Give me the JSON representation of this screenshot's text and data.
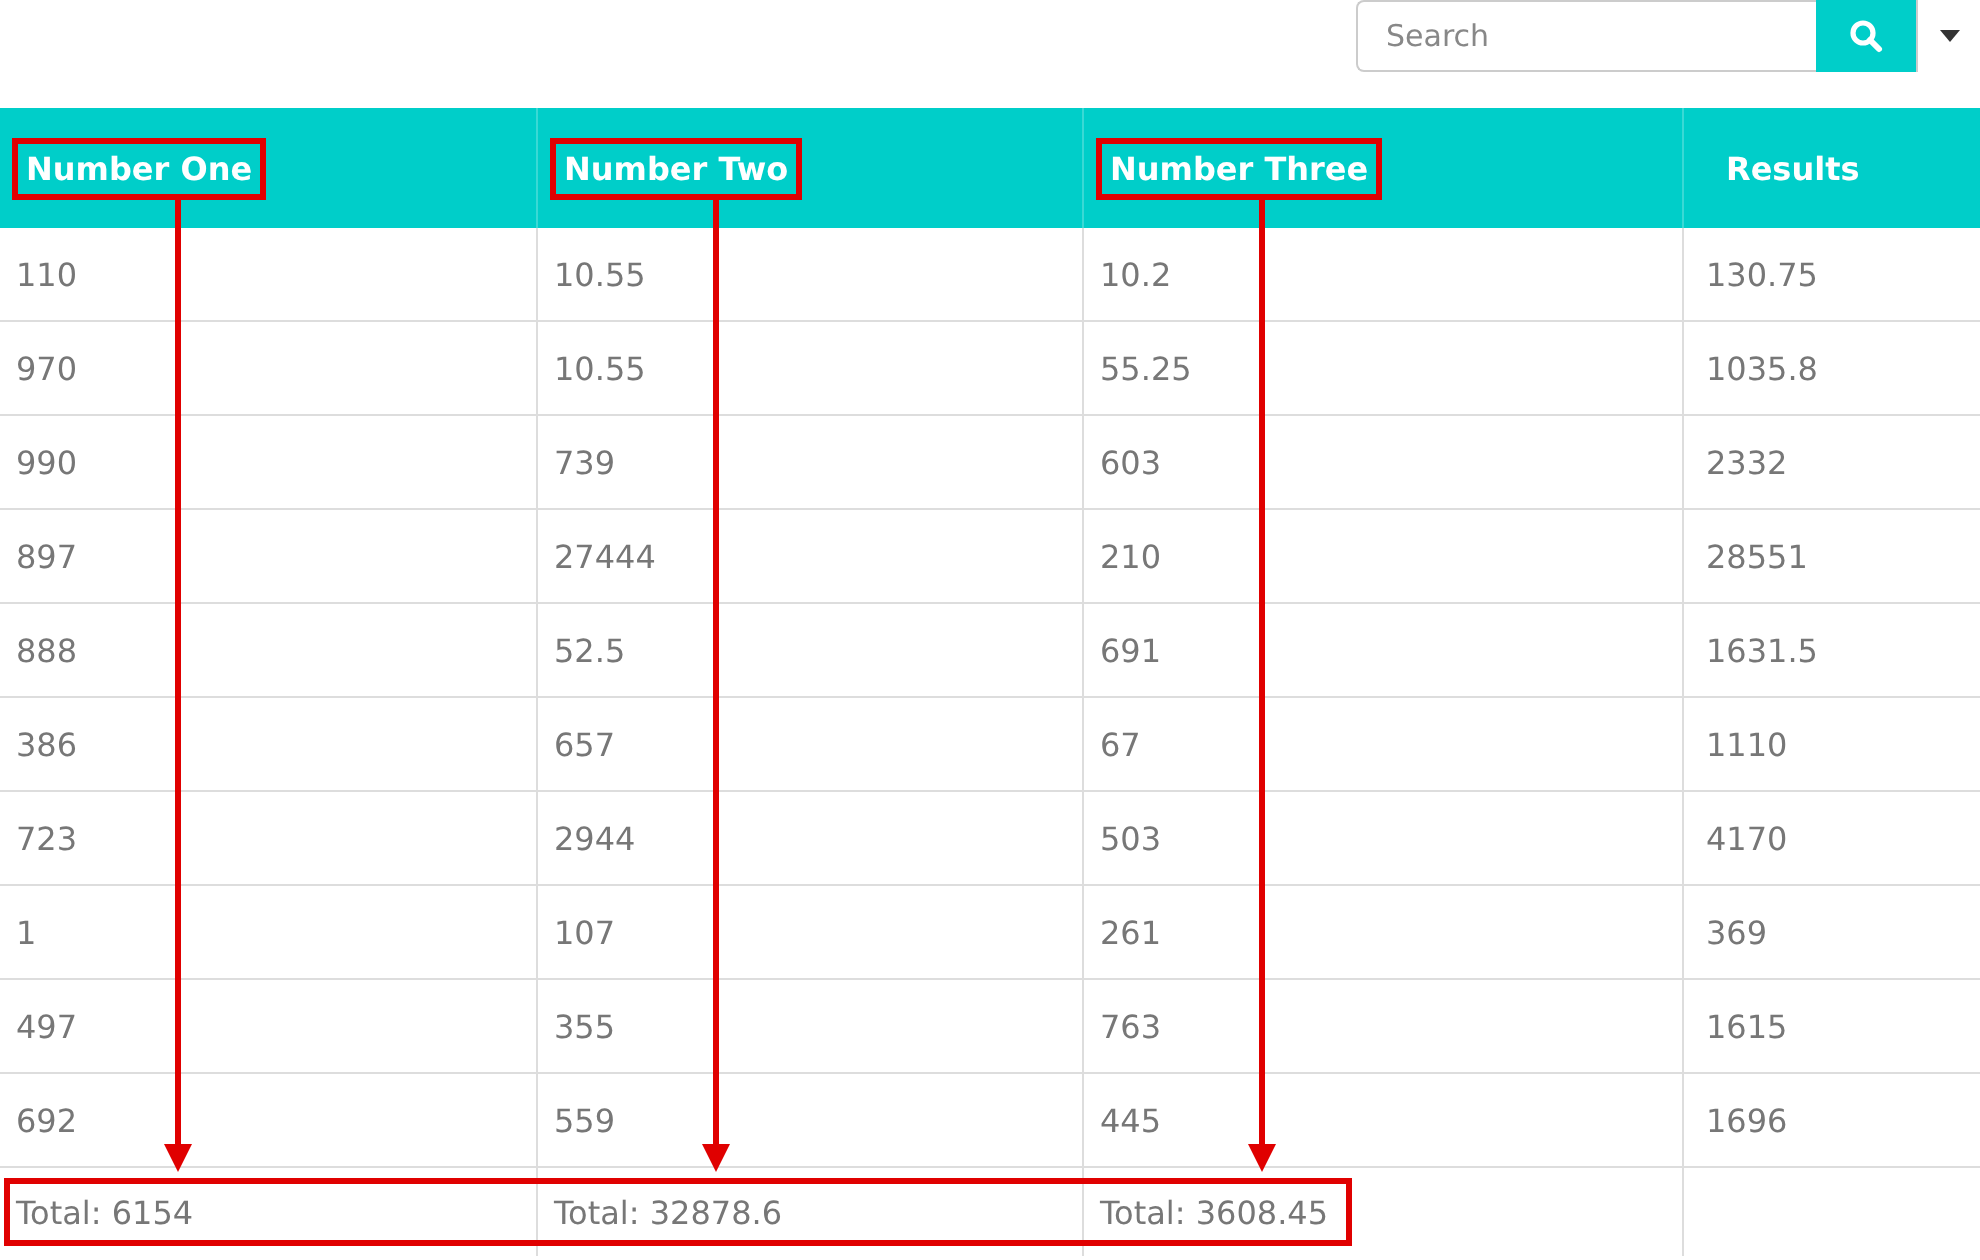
{
  "search": {
    "placeholder": "Search"
  },
  "table": {
    "columns": [
      {
        "label": "Number One",
        "highlighted": true
      },
      {
        "label": "Number Two",
        "highlighted": true
      },
      {
        "label": "Number Three",
        "highlighted": true
      },
      {
        "label": "Results",
        "highlighted": false
      }
    ],
    "rows": [
      [
        "110",
        "10.55",
        "10.2",
        "130.75"
      ],
      [
        "970",
        "10.55",
        "55.25",
        "1035.8"
      ],
      [
        "990",
        "739",
        "603",
        "2332"
      ],
      [
        "897",
        "27444",
        "210",
        "28551"
      ],
      [
        "888",
        "52.5",
        "691",
        "1631.5"
      ],
      [
        "386",
        "657",
        "67",
        "1110"
      ],
      [
        "723",
        "2944",
        "503",
        "4170"
      ],
      [
        "1",
        "107",
        "261",
        "369"
      ],
      [
        "497",
        "355",
        "763",
        "1615"
      ],
      [
        "692",
        "559",
        "445",
        "1696"
      ]
    ],
    "footer": {
      "highlighted": true,
      "totals": [
        "Total: 6154",
        "Total: 32878.6",
        "Total: 3608.45"
      ]
    }
  }
}
